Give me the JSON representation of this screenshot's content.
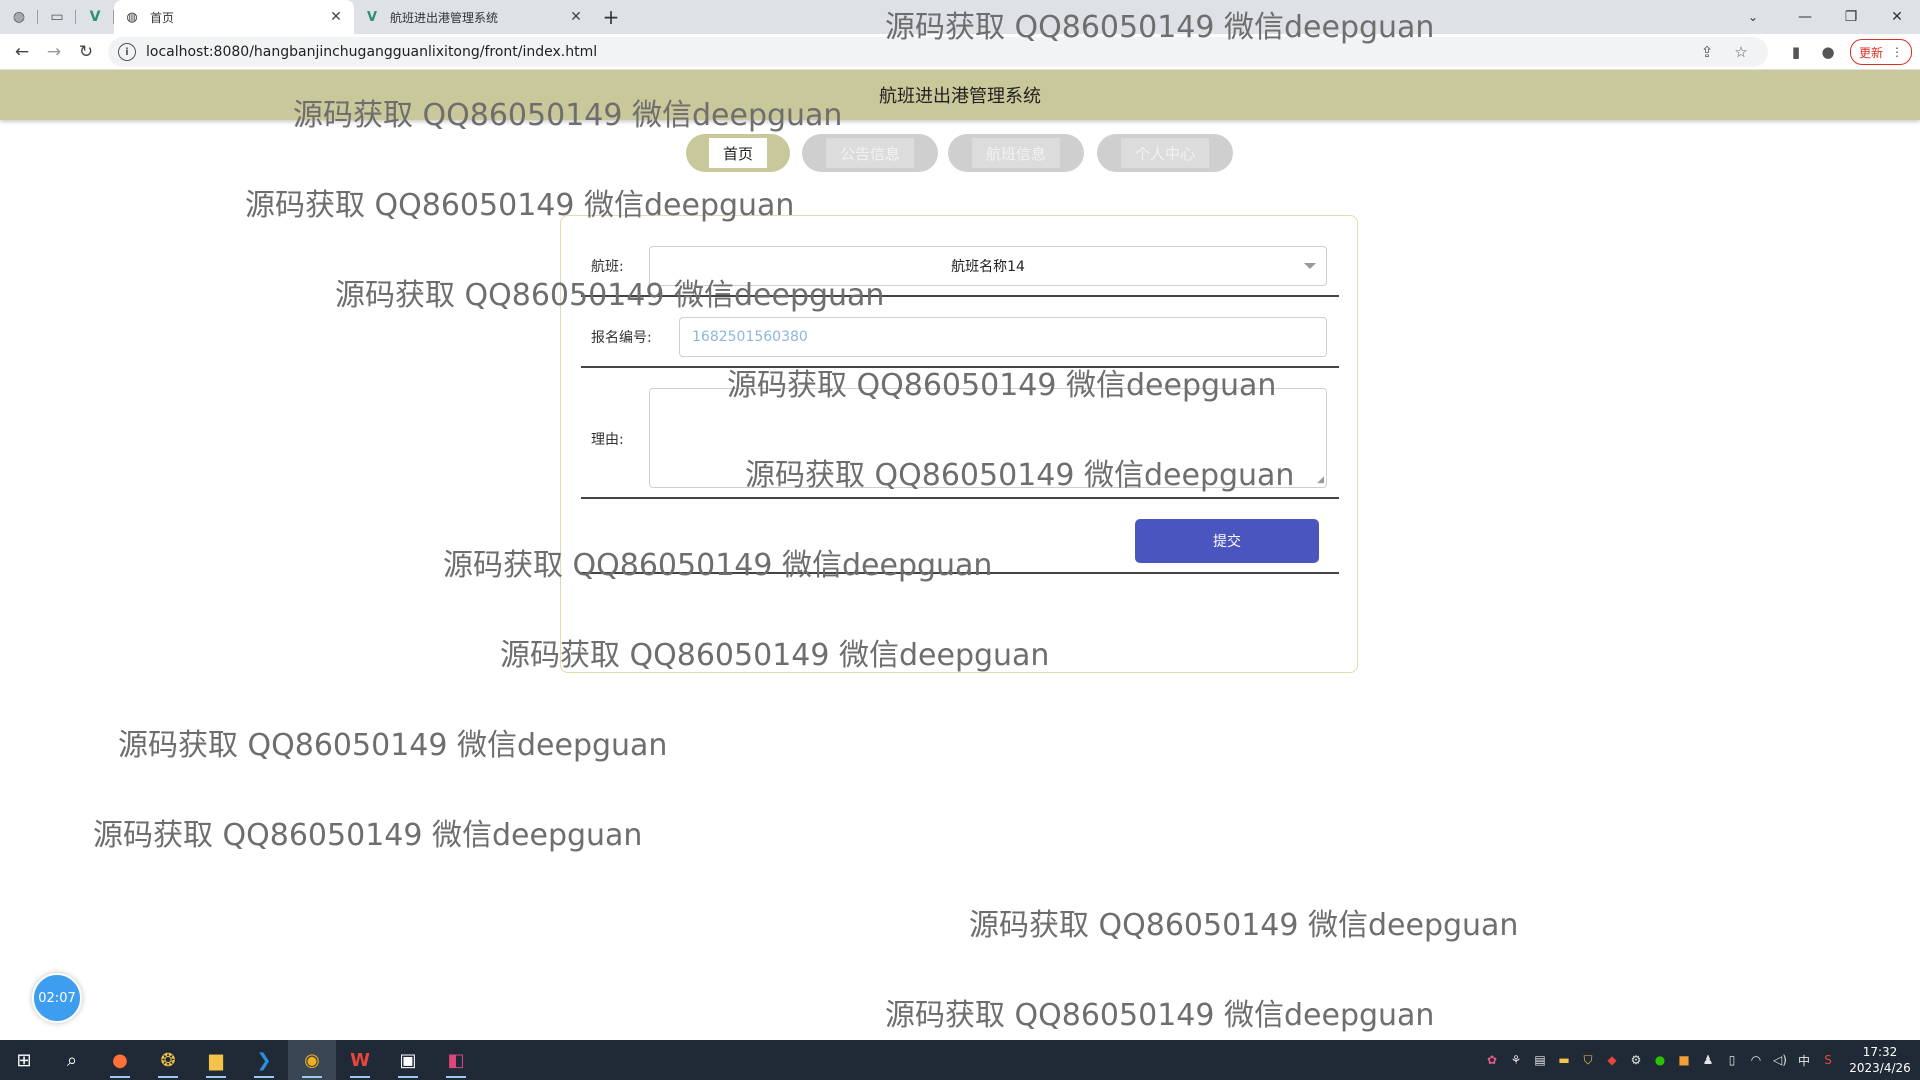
{
  "browser": {
    "tabs": [
      {
        "label": "首页",
        "active": true
      },
      {
        "label": "航班进出港管理系统",
        "active": false
      }
    ],
    "url": "localhost:8080/hangbanjinchugangguanlixitong/front/index.html",
    "update_label": "更新"
  },
  "site": {
    "title": "航班进出港管理系统",
    "nav": [
      {
        "label": "首页",
        "active": true
      },
      {
        "label": "公告信息",
        "active": false
      },
      {
        "label": "航班信息",
        "active": false
      },
      {
        "label": "个人中心",
        "active": false
      }
    ]
  },
  "form": {
    "flight_label": "航班:",
    "flight_value": "航班名称14",
    "reg_label": "报名编号:",
    "reg_value": "1682501560380",
    "reason_label": "理由:",
    "reason_value": "",
    "submit_label": "提交"
  },
  "timer": "02:07",
  "watermark": "源码获取 QQ86050149 微信deepguan",
  "taskbar": {
    "time": "17:32",
    "date": "2023/4/26",
    "ime": "中"
  }
}
